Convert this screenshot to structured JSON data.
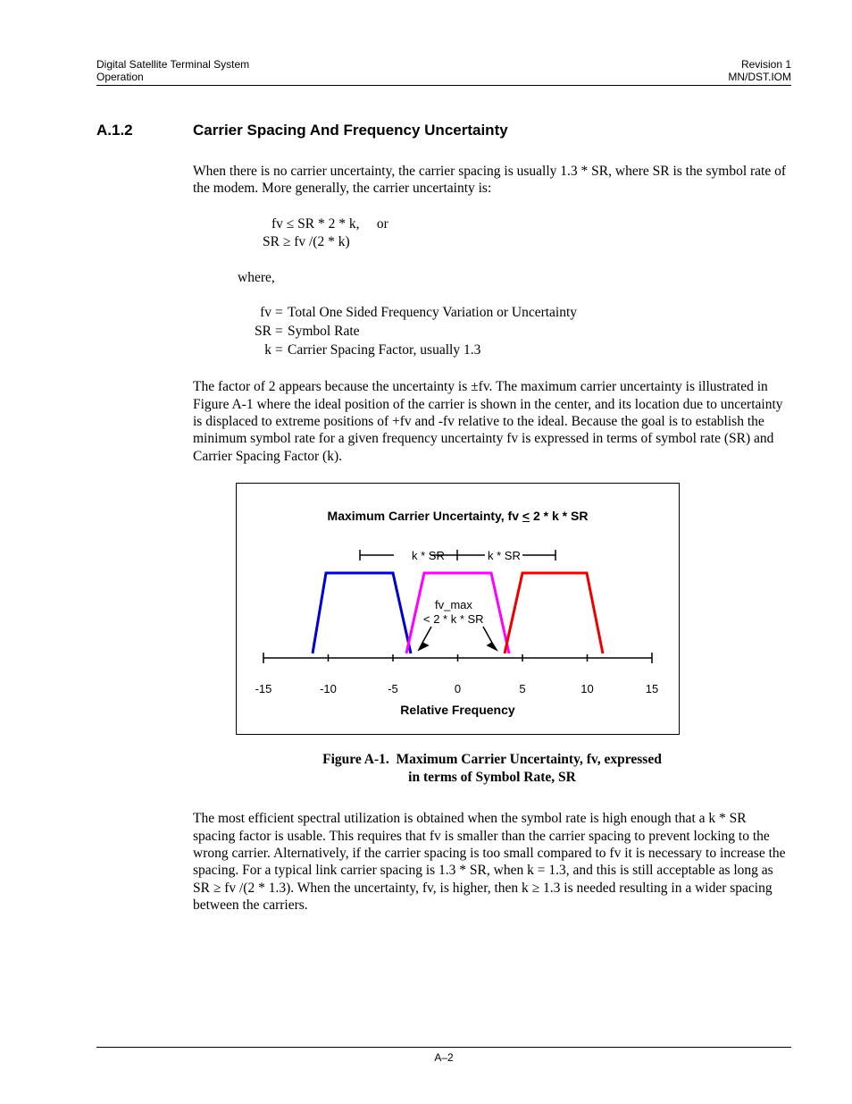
{
  "header": {
    "left1": "Digital Satellite Terminal System",
    "left2": "Operation",
    "right1": "Revision 1",
    "right2": "MN/DST.IOM"
  },
  "section": {
    "number": "A.1.2",
    "title": "Carrier Spacing And Frequency Uncertainty"
  },
  "para1": "When there is no carrier uncertainty, the carrier spacing is usually 1.3 * SR, where SR is the symbol rate of the modem. More generally, the carrier uncertainty is:",
  "eq1": "fv ≤ SR * 2 * k,     or",
  "eq2": "SR ≥ fv /(2 * k)",
  "where_label": "where,",
  "defs": {
    "fv": {
      "sym": "fv",
      "txt": "Total One Sided Frequency Variation or Uncertainty"
    },
    "sr": {
      "sym": "SR",
      "txt": "Symbol Rate"
    },
    "k": {
      "sym": "k",
      "txt": "Carrier Spacing Factor, usually 1.3"
    }
  },
  "para2": "The factor of 2 appears because the uncertainty is ±fv. The maximum carrier uncertainty is illustrated in Figure A-1 where the ideal position of the carrier is shown in the center, and its location due to uncertainty is displaced to extreme positions of +fv and -fv relative to the ideal. Because the goal is to establish the minimum symbol rate for a given frequency uncertainty fv is expressed in terms of symbol rate (SR) and Carrier Spacing Factor (k).",
  "figure": {
    "caption_l1": "Figure A-1.  Maximum Carrier Uncertainty, fv, expressed",
    "caption_l2": "in terms of Symbol Rate, SR"
  },
  "para3": "The most efficient spectral utilization is obtained when the symbol rate is high enough that a k * SR spacing factor is usable. This requires that fv is smaller than the carrier spacing to prevent locking to the wrong carrier. Alternatively, if the carrier spacing is too small compared to fv it is necessary to increase the spacing. For a typical link carrier spacing is 1.3 * SR, when k = 1.3, and this is still acceptable as long as SR ≥ fv /(2 * 1.3). When the uncertainty, fv, is higher, then k ≥ 1.3 is needed resulting in a wider spacing between the carriers.",
  "footer": {
    "page": "A–2"
  },
  "chart_data": {
    "type": "line",
    "title": "Maximum Carrier Uncertainty, fv ≤ 2 * k * SR",
    "xlabel": "Relative Frequency",
    "ylabel": "",
    "x_ticks": [
      -15,
      -10,
      -5,
      0,
      5,
      10,
      15
    ],
    "annotations": {
      "left_span": "k * SR",
      "right_span": "k * SR",
      "center_top": "fv_max",
      "center_bot": "< 2 * k * SR"
    },
    "series": [
      {
        "name": "left-carrier",
        "color": "#0000cc",
        "x": [
          -11.5,
          -10,
          -5,
          -3.5
        ],
        "y": [
          0,
          1,
          1,
          0
        ]
      },
      {
        "name": "center-carrier",
        "color": "#ff00ff",
        "x": [
          -4,
          -2.5,
          2.5,
          4
        ],
        "y": [
          0,
          1,
          1,
          0
        ]
      },
      {
        "name": "right-carrier",
        "color": "#ee0000",
        "x": [
          3.5,
          5,
          10,
          11.5
        ],
        "y": [
          0,
          1,
          1,
          0
        ]
      }
    ],
    "xlim": [
      -15,
      15
    ],
    "ylim": [
      0,
      1
    ]
  }
}
